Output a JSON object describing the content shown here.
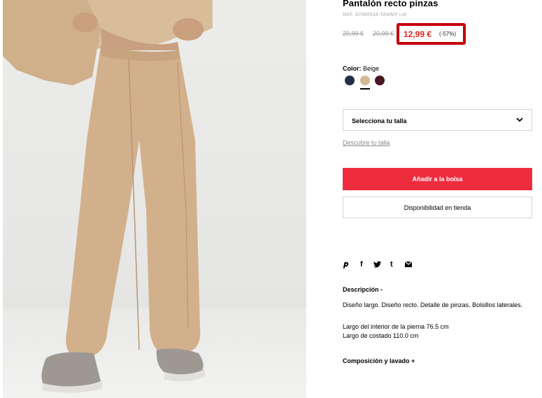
{
  "product": {
    "title": "Pantalón recto pinzas",
    "ref": "REF. 87080534-TAMMY-LM",
    "price_original_1": "29,99 €",
    "price_original_2": "20,99 €",
    "price_current": "12,99 €",
    "discount": "(-57%)"
  },
  "color": {
    "label": "Color:",
    "selected": "Beige",
    "swatches": [
      {
        "name": "navy",
        "color": "#252d46"
      },
      {
        "name": "beige",
        "color": "#d5b896"
      },
      {
        "name": "burgundy",
        "color": "#4a1822"
      }
    ]
  },
  "size": {
    "select_label": "Selecciona tu talla",
    "guide_link": "Descubre tu talla"
  },
  "actions": {
    "add_to_bag": "Añadir a la bolsa",
    "store_availability": "Disponibilidad en tienda"
  },
  "share": {
    "icons": [
      "pinterest-icon",
      "facebook-icon",
      "twitter-icon",
      "tumblr-icon",
      "email-icon"
    ],
    "glyphs": [
      "𝒑",
      "f",
      "🐦",
      "t",
      "✉"
    ]
  },
  "description": {
    "title": "Descripción -",
    "body": "Diseño largo. Diseño recto. Detalle de pinzas. Bolsillos laterales.",
    "measure_1": "Largo del interior de la pierna 76.5 cm",
    "measure_2": "Largo de costado 110.0 cm"
  },
  "composition": {
    "title": "Composición y lavado +"
  },
  "colors": {
    "accent_red": "#ef2b3e",
    "price_red": "#e1251b",
    "highlight_box": "#c3000a"
  }
}
